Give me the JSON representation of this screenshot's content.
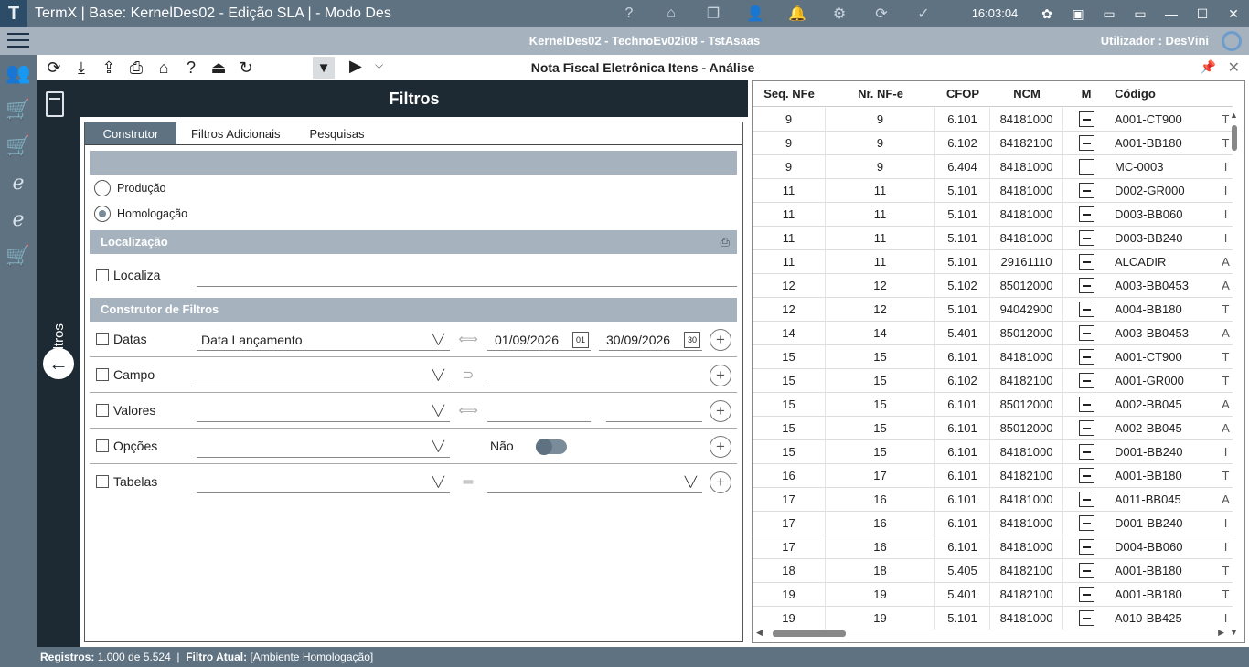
{
  "window": {
    "logo_letter": "T",
    "title": "TermX | Base: KernelDes02 - Edição SLA | - Modo Des",
    "clock": "16:03:04",
    "title_icons": [
      "?",
      "⌂",
      "❐",
      "👤",
      "🔔",
      "⚙",
      "⟳",
      "✓"
    ],
    "right_icons": [
      "⚑",
      "▣",
      "▭"
    ],
    "min": "—",
    "max": "☐",
    "close": "✕"
  },
  "infobar": {
    "session": "KernelDes02 - TechnoEv02i08 - TstAsaas",
    "user": "Utilizador :  DesVini"
  },
  "toolbar": {
    "page_title": "Nota Fiscal Eletrônica Itens - Análise"
  },
  "filters": {
    "title": "Filtros",
    "vertical_label": "Filtros",
    "tabs": [
      "Construtor",
      "Filtros Adicionais",
      "Pesquisas"
    ],
    "environment": {
      "producao": "Produção",
      "homologacao": "Homologação"
    },
    "localizacao": {
      "header": "Localização",
      "checkbox_label": "Localiza"
    },
    "construtor": {
      "header": "Construtor de Filtros",
      "rows": [
        {
          "label": "Datas",
          "combo": "Data Lançamento",
          "from": "01/09/2026",
          "to": "30/09/2026"
        },
        {
          "label": "Campo",
          "combo": ""
        },
        {
          "label": "Valores",
          "combo": ""
        },
        {
          "label": "Opções",
          "combo": "",
          "toggle_label": "Não"
        },
        {
          "label": "Tabelas",
          "combo": ""
        }
      ]
    }
  },
  "grid": {
    "columns": [
      "Seq. NFe",
      "Nr. NF-e",
      "CFOP",
      "NCM",
      "M",
      "Código"
    ],
    "rows": [
      {
        "seq": "9",
        "nr": "9",
        "cfop": "6.101",
        "ncm": "84181000",
        "m": true,
        "codigo": "A001-CT900",
        "extra": "T"
      },
      {
        "seq": "9",
        "nr": "9",
        "cfop": "6.102",
        "ncm": "84182100",
        "m": true,
        "codigo": "A001-BB180",
        "extra": "T"
      },
      {
        "seq": "9",
        "nr": "9",
        "cfop": "6.404",
        "ncm": "84181000",
        "m": false,
        "codigo": "MC-0003",
        "extra": "I"
      },
      {
        "seq": "11",
        "nr": "11",
        "cfop": "5.101",
        "ncm": "84181000",
        "m": true,
        "codigo": "D002-GR000",
        "extra": "I"
      },
      {
        "seq": "11",
        "nr": "11",
        "cfop": "5.101",
        "ncm": "84181000",
        "m": true,
        "codigo": "D003-BB060",
        "extra": "I"
      },
      {
        "seq": "11",
        "nr": "11",
        "cfop": "5.101",
        "ncm": "84181000",
        "m": true,
        "codigo": "D003-BB240",
        "extra": "I"
      },
      {
        "seq": "11",
        "nr": "11",
        "cfop": "5.101",
        "ncm": "29161110",
        "m": true,
        "codigo": "ALCADIR",
        "extra": "A"
      },
      {
        "seq": "12",
        "nr": "12",
        "cfop": "5.102",
        "ncm": "85012000",
        "m": true,
        "codigo": "A003-BB0453",
        "extra": "A"
      },
      {
        "seq": "12",
        "nr": "12",
        "cfop": "5.101",
        "ncm": "94042900",
        "m": true,
        "codigo": "A004-BB180",
        "extra": "T"
      },
      {
        "seq": "14",
        "nr": "14",
        "cfop": "5.401",
        "ncm": "85012000",
        "m": true,
        "codigo": "A003-BB0453",
        "extra": "A"
      },
      {
        "seq": "15",
        "nr": "15",
        "cfop": "6.101",
        "ncm": "84181000",
        "m": true,
        "codigo": "A001-CT900",
        "extra": "T"
      },
      {
        "seq": "15",
        "nr": "15",
        "cfop": "6.102",
        "ncm": "84182100",
        "m": true,
        "codigo": "A001-GR000",
        "extra": "T"
      },
      {
        "seq": "15",
        "nr": "15",
        "cfop": "6.101",
        "ncm": "85012000",
        "m": true,
        "codigo": "A002-BB045",
        "extra": "A"
      },
      {
        "seq": "15",
        "nr": "15",
        "cfop": "6.101",
        "ncm": "85012000",
        "m": true,
        "codigo": "A002-BB045",
        "extra": "A"
      },
      {
        "seq": "15",
        "nr": "15",
        "cfop": "6.101",
        "ncm": "84181000",
        "m": true,
        "codigo": "D001-BB240",
        "extra": "I"
      },
      {
        "seq": "16",
        "nr": "17",
        "cfop": "6.101",
        "ncm": "84182100",
        "m": true,
        "codigo": "A001-BB180",
        "extra": "T"
      },
      {
        "seq": "17",
        "nr": "16",
        "cfop": "6.101",
        "ncm": "84181000",
        "m": true,
        "codigo": "A011-BB045",
        "extra": "A"
      },
      {
        "seq": "17",
        "nr": "16",
        "cfop": "6.101",
        "ncm": "84181000",
        "m": true,
        "codigo": "D001-BB240",
        "extra": "I"
      },
      {
        "seq": "17",
        "nr": "16",
        "cfop": "6.101",
        "ncm": "84181000",
        "m": true,
        "codigo": "D004-BB060",
        "extra": "I"
      },
      {
        "seq": "18",
        "nr": "18",
        "cfop": "5.405",
        "ncm": "84182100",
        "m": true,
        "codigo": "A001-BB180",
        "extra": "T"
      },
      {
        "seq": "19",
        "nr": "19",
        "cfop": "5.401",
        "ncm": "84182100",
        "m": true,
        "codigo": "A001-BB180",
        "extra": "T"
      },
      {
        "seq": "19",
        "nr": "19",
        "cfop": "5.101",
        "ncm": "84181000",
        "m": true,
        "codigo": "A010-BB425",
        "extra": "I"
      }
    ]
  },
  "status": {
    "registros_label": "Registros:",
    "registros_value": "1.000 de 5.524",
    "filtro_label": "Filtro Atual:",
    "filtro_value": "[Ambiente Homologação]"
  },
  "colors": {
    "titlebar": "#5f7282",
    "dark_panel": "#1e2a33",
    "section_bar": "#a6b3bf"
  }
}
